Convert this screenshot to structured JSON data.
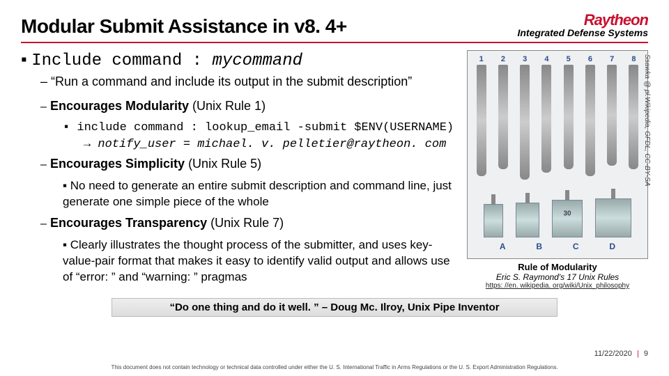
{
  "header": {
    "title": "Modular Submit Assistance in v8. 4+",
    "logo_name": "Raytheon",
    "logo_sub": "Integrated Defense Systems"
  },
  "main": {
    "bullet_lead": "Include command : ",
    "bullet_cmd": "mycommand",
    "sub1": "– “Run a command and include its output in the submit description”",
    "mod": {
      "label": "Encourages Modularity",
      "paren": " (Unix Rule 1)",
      "code": "include command : lookup_email -submit $ENV(USERNAME)",
      "arrow": "→ notify_user = michael. v. pelletier@raytheon. com"
    },
    "simp": {
      "label": "Encourages Simplicity",
      "paren": " (Unix Rule 5)",
      "text": "No need to generate an entire submit description and command line, just generate one simple piece of the whole"
    },
    "trans": {
      "label": "Encourages Transparency",
      "paren": " (Unix Rule 7)",
      "text": "Clearly illustrates the thought process of the submitter, and uses key-value-pair format that makes it easy to identify valid output and allows use of “error: ” and “warning: ” pragmas"
    }
  },
  "figure": {
    "nums": [
      "1",
      "2",
      "3",
      "4",
      "5",
      "6",
      "7",
      "8"
    ],
    "letters": [
      "A",
      "B",
      "C",
      "D"
    ],
    "spade_size": "30",
    "credit": "Ssawka @ pl.Wikipedia, GFDL, CC-BY-SA",
    "cap1": "Rule of Modularity",
    "cap2": "Eric S. Raymond's 17 Unix Rules",
    "cap3": "https: //en. wikipedia. org/wiki/Unix_philosophy"
  },
  "quote": "“Do one thing and do it well. ” – Doug Mc. Ilroy, Unix Pipe Inventor",
  "footer": {
    "date": "11/22/2020",
    "page": "9"
  },
  "disclaimer": "This document does not contain technology or technical data controlled under either the U. S. International Traffic in Arms Regulations or the U. S. Export Administration Regulations."
}
